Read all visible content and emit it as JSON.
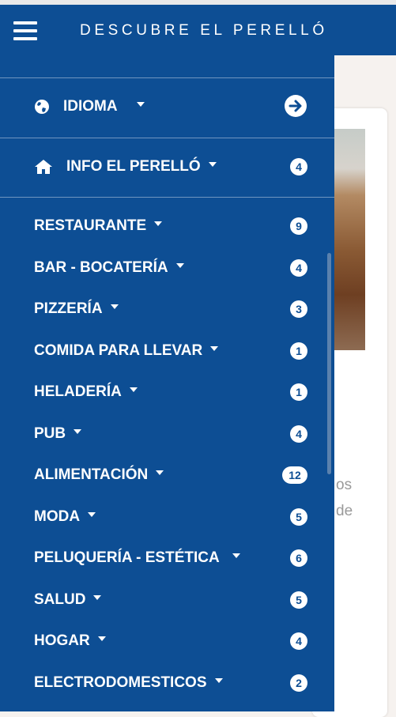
{
  "topbar": {
    "title": "DESCUBRE EL PERELLÓ"
  },
  "drawer": {
    "language": {
      "label": "IDIOMA"
    },
    "info": {
      "label": "INFO EL PERELLÓ",
      "count": "4"
    },
    "categories": [
      {
        "label": "RESTAURANTE",
        "count": "9"
      },
      {
        "label": "BAR - BOCATERÍA",
        "count": "4"
      },
      {
        "label": "PIZZERÍA",
        "count": "3"
      },
      {
        "label": "COMIDA PARA LLEVAR",
        "count": "1"
      },
      {
        "label": "HELADERÍA",
        "count": "1"
      },
      {
        "label": "PUB",
        "count": "4"
      },
      {
        "label": "ALIMENTACIÓN",
        "count": "12"
      },
      {
        "label": "MODA",
        "count": "5"
      },
      {
        "label": "PELUQUERÍA - ESTÉTICA",
        "count": "6"
      },
      {
        "label": "SALUD",
        "count": "5"
      },
      {
        "label": "HOGAR",
        "count": "4"
      },
      {
        "label": "ELECTRODOMESTICOS",
        "count": "2"
      }
    ]
  },
  "background": {
    "text_line1": "os",
    "text_line2": "de"
  },
  "colors": {
    "primary": "#0d4e94",
    "badge_bg": "#ffffff"
  }
}
